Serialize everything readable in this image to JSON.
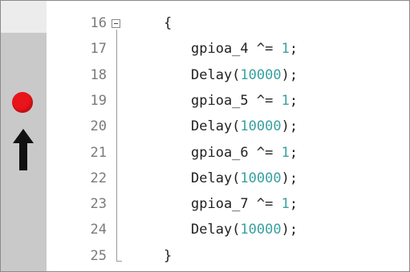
{
  "editor": {
    "breakpoint_color": "#e8151b",
    "arrow_icon": "up-arrow-icon",
    "lines": [
      {
        "number": "16",
        "indent": "",
        "text": "{",
        "num": "",
        "suffix": ""
      },
      {
        "number": "17",
        "indent": "  ",
        "text": "gpioa_4 ^= ",
        "num": "1",
        "suffix": ";"
      },
      {
        "number": "18",
        "indent": "  ",
        "text": "Delay(",
        "num": "10000",
        "suffix": ");"
      },
      {
        "number": "19",
        "indent": "  ",
        "text": "gpioa_5 ^= ",
        "num": "1",
        "suffix": ";"
      },
      {
        "number": "20",
        "indent": "  ",
        "text": "Delay(",
        "num": "10000",
        "suffix": ");"
      },
      {
        "number": "21",
        "indent": "  ",
        "text": "gpioa_6 ^= ",
        "num": "1",
        "suffix": ";"
      },
      {
        "number": "22",
        "indent": "  ",
        "text": "Delay(",
        "num": "10000",
        "suffix": ");"
      },
      {
        "number": "23",
        "indent": "  ",
        "text": "gpioa_7 ^= ",
        "num": "1",
        "suffix": ";"
      },
      {
        "number": "24",
        "indent": "  ",
        "text": "Delay(",
        "num": "10000",
        "suffix": ");"
      },
      {
        "number": "25",
        "indent": "",
        "text": "}",
        "num": "",
        "suffix": ""
      }
    ]
  }
}
